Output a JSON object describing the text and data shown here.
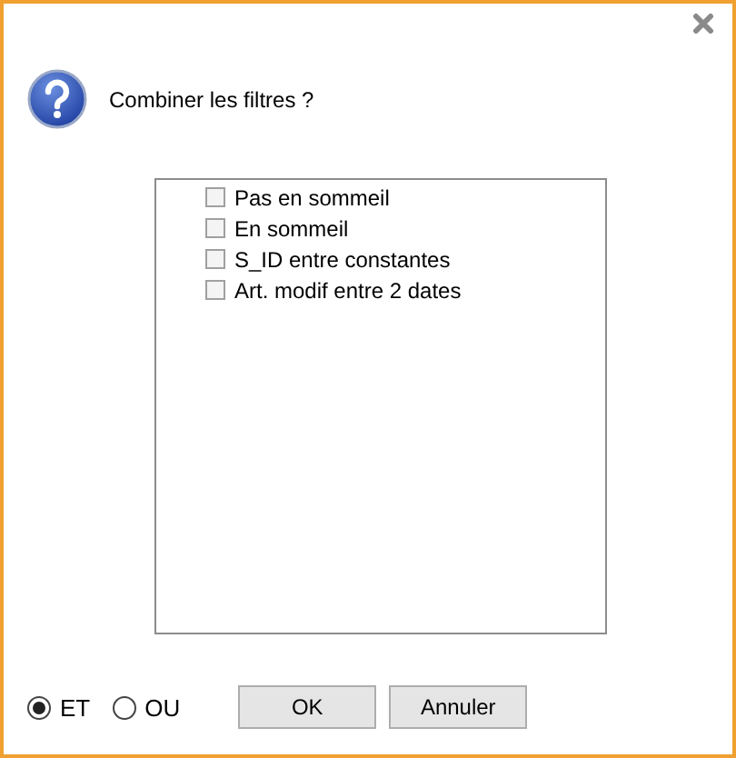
{
  "dialog": {
    "message": "Combiner les filtres ?"
  },
  "filters": [
    {
      "label": "Pas en sommeil",
      "checked": false
    },
    {
      "label": "En sommeil",
      "checked": false
    },
    {
      "label": "S_ID entre constantes",
      "checked": false
    },
    {
      "label": "Art. modif entre 2 dates",
      "checked": false
    }
  ],
  "operators": [
    {
      "label": "ET",
      "selected": true
    },
    {
      "label": "OU",
      "selected": false
    }
  ],
  "buttons": [
    {
      "label": "OK"
    },
    {
      "label": "Annuler"
    }
  ]
}
